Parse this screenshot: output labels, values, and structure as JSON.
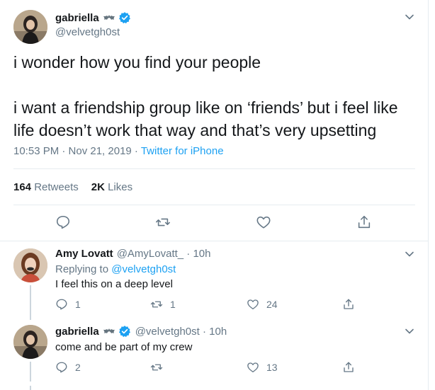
{
  "main_tweet": {
    "display_name": "gabriella",
    "handle": "@velvetgh0st",
    "text": "i wonder how you find your people\n\ni want a friendship group like on ‘friends’ but i feel like life doesn’t work that way and that’s very upsetting",
    "time": "10:53 PM · Nov 21, 2019 · ",
    "source": "Twitter for iPhone",
    "retweets_count": "164",
    "retweets_label": "Retweets",
    "likes_count": "2K",
    "likes_label": "Likes"
  },
  "replies": [
    {
      "display_name": "Amy Lovatt",
      "handle": "@AmyLovatt_ · 10h",
      "replying_prefix": "Replying to ",
      "replying_to": "@velvetgh0st",
      "text": "I feel this on a deep level",
      "reply_count": "1",
      "retweet_count": "1",
      "like_count": "24"
    },
    {
      "display_name": "gabriella",
      "handle": "@velvetgh0st · 10h",
      "text": "come and be part of my crew",
      "reply_count": "2",
      "retweet_count": "",
      "like_count": "13"
    }
  ],
  "colors": {
    "accent": "#1da1f2",
    "muted": "#657786",
    "border": "#e6ecf0",
    "text": "#14171a"
  },
  "icons": [
    "avatar",
    "bat-emoji-icon",
    "verified-badge-icon",
    "chevron-down-icon",
    "reply-icon",
    "retweet-icon",
    "like-icon",
    "share-icon"
  ]
}
